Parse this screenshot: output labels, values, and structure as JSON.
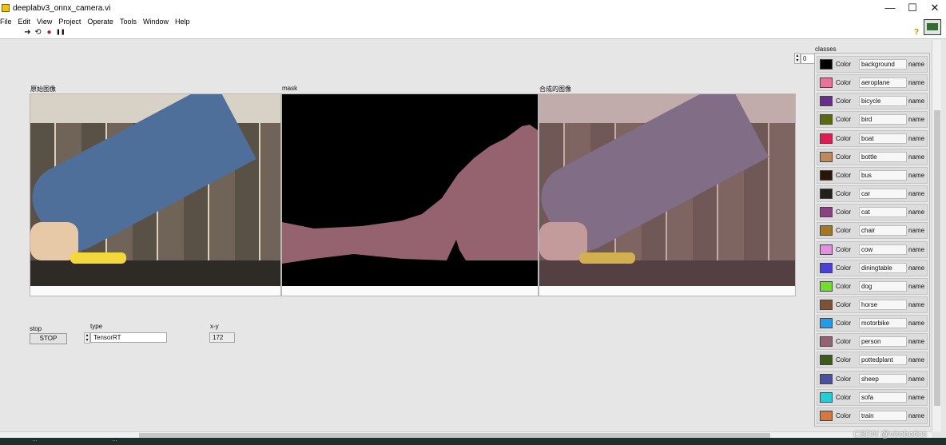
{
  "window": {
    "title": "deeplabv3_onnx_camera.vi",
    "controls": {
      "minimize": "—",
      "maximize": "☐",
      "close": "✕"
    }
  },
  "menu": [
    "File",
    "Edit",
    "View",
    "Project",
    "Operate",
    "Tools",
    "Window",
    "Help"
  ],
  "toolbar": {
    "icons": [
      "run-arrow",
      "run-continuously",
      "abort-execution",
      "pause"
    ],
    "glyphs": {
      "run": "➜",
      "run_cont": "⟲",
      "abort": "●",
      "pause": "❚❚",
      "help": "?"
    }
  },
  "panels": {
    "original_label": "原始图像",
    "mask_label": "mask",
    "composite_label": "合成的图像"
  },
  "controls": {
    "stop_label": "stop",
    "stop_button": "STOP",
    "type_label": "type",
    "type_value": "TensorRT",
    "xy_label": "x-y",
    "xy_value": "172"
  },
  "classes": {
    "label": "classes",
    "index": "0",
    "color_label": "Color",
    "name_label": "name",
    "items": [
      {
        "name": "background",
        "color": "#000000"
      },
      {
        "name": "aeroplane",
        "color": "#e8739a"
      },
      {
        "name": "bicycle",
        "color": "#6b2c91"
      },
      {
        "name": "bird",
        "color": "#5b6a12"
      },
      {
        "name": "boat",
        "color": "#e31b55"
      },
      {
        "name": "bottle",
        "color": "#c0895a"
      },
      {
        "name": "bus",
        "color": "#2a1608"
      },
      {
        "name": "car",
        "color": "#22201b"
      },
      {
        "name": "cat",
        "color": "#8e3f82"
      },
      {
        "name": "chair",
        "color": "#a5781f"
      },
      {
        "name": "cow",
        "color": "#e28fe4"
      },
      {
        "name": "diningtable",
        "color": "#4b3fd6"
      },
      {
        "name": "dog",
        "color": "#6fe02a"
      },
      {
        "name": "horse",
        "color": "#7c5335"
      },
      {
        "name": "motorbike",
        "color": "#1e9ee8"
      },
      {
        "name": "person",
        "color": "#94636f"
      },
      {
        "name": "pottedplant",
        "color": "#3c5c18"
      },
      {
        "name": "sheep",
        "color": "#4a4fa6"
      },
      {
        "name": "sofa",
        "color": "#23cfd6"
      },
      {
        "name": "train",
        "color": "#d7773a"
      }
    ]
  },
  "taskbar": {
    "item1": "…",
    "item2": "…"
  },
  "watermark": "CSDN @virobotics"
}
